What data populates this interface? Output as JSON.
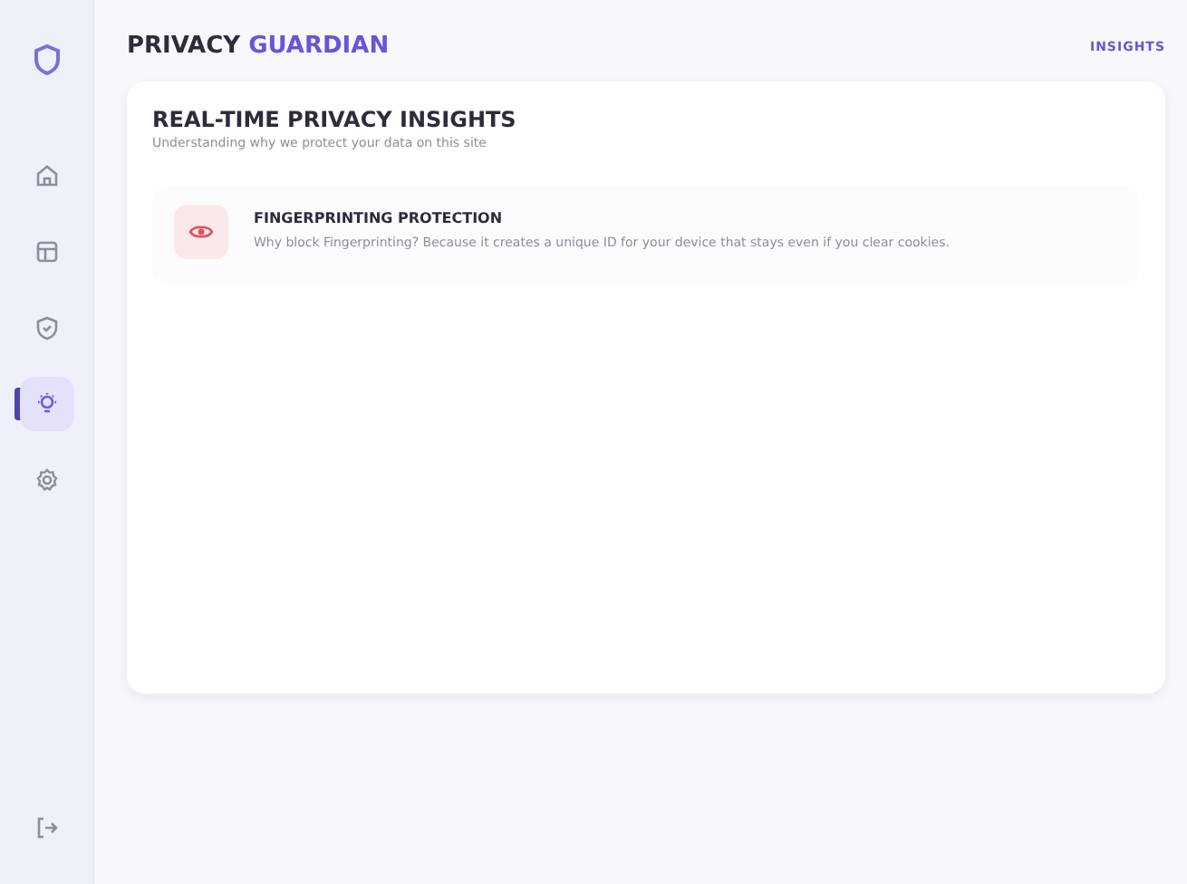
{
  "sidebar": {
    "items": [
      {
        "kind": "home",
        "selected": false
      },
      {
        "kind": "layout",
        "selected": false
      },
      {
        "kind": "shield",
        "selected": false
      },
      {
        "kind": "bulb",
        "selected": true
      },
      {
        "kind": "gear",
        "selected": false
      }
    ]
  },
  "header": {
    "title": "PRIVACY",
    "title_accent": "GUARDIAN",
    "nav_link": "INSIGHTS"
  },
  "card": {
    "title": "REAL-TIME PRIVACY INSIGHTS",
    "subtitle": "Understanding why we protect your data on this site",
    "insights": [
      {
        "kind": "eye",
        "title": "FINGERPRINTING PROTECTION",
        "text": "Why block Fingerprinting? Because it creates a unique ID for your device that stays even if you clear cookies."
      }
    ]
  }
}
